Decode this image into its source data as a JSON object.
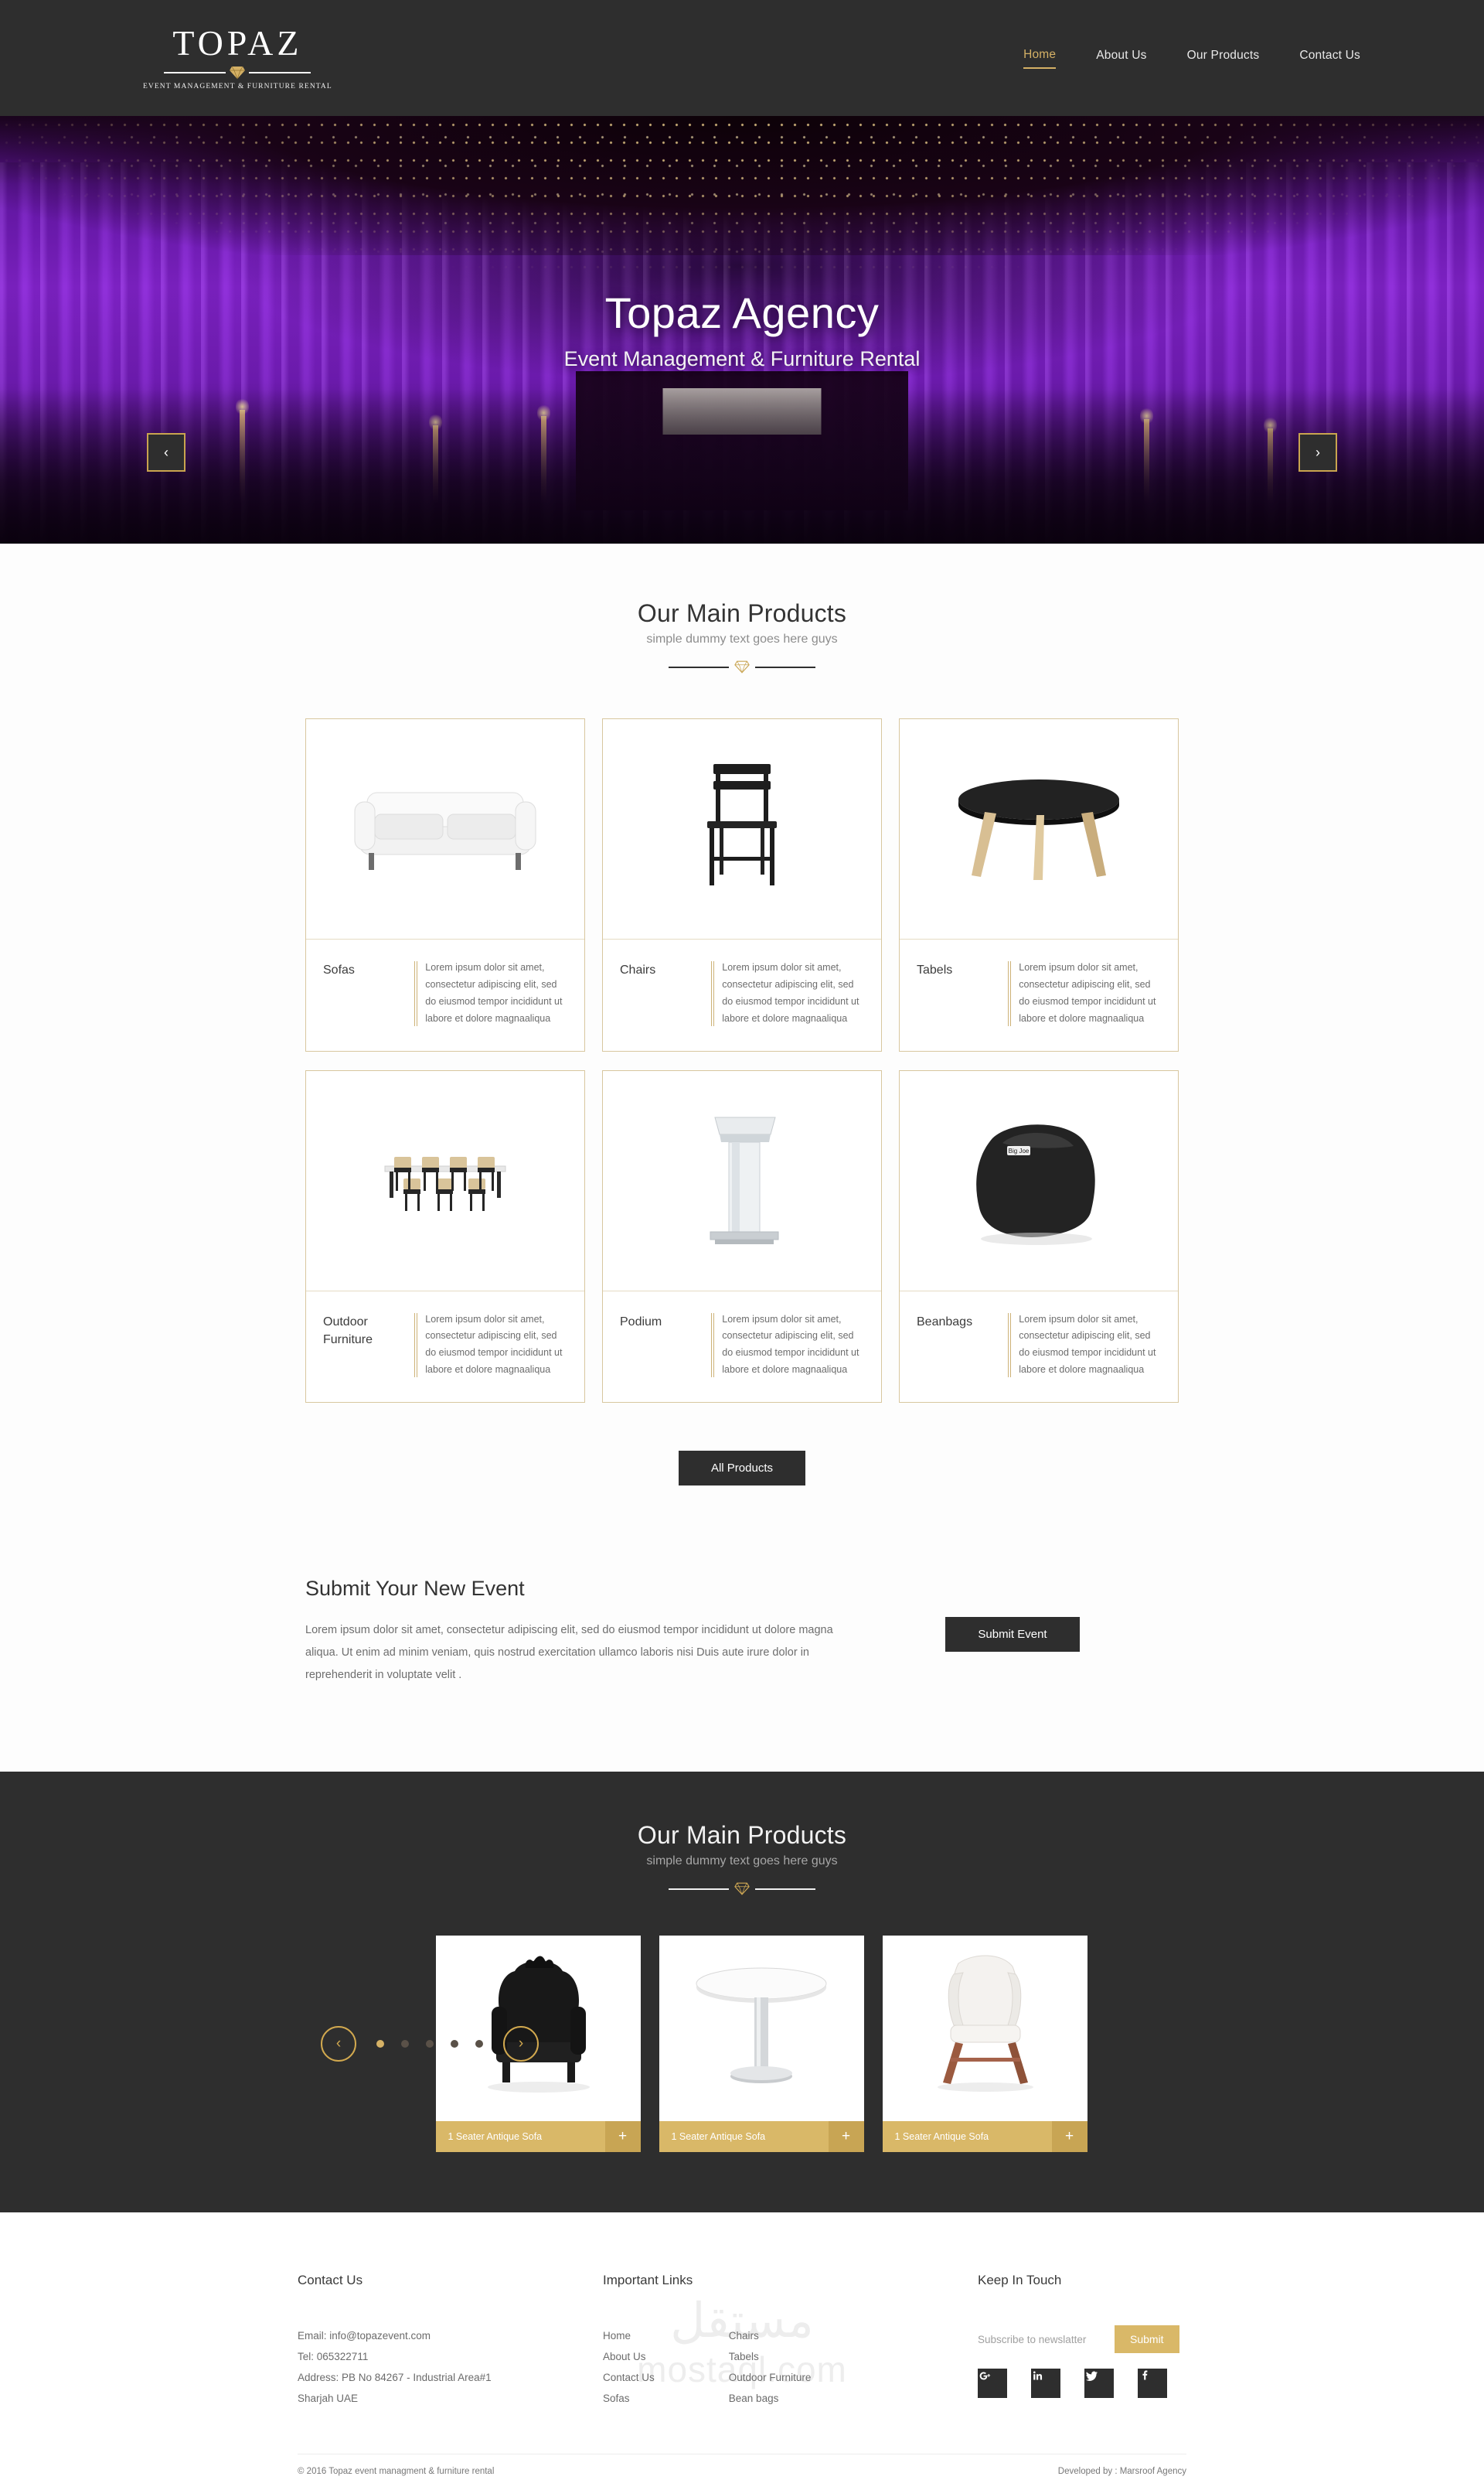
{
  "header": {
    "logo_word": "TOPAZ",
    "logo_tagline": "EVENT MANAGEMENT & FURNITURE RENTAL",
    "nav": [
      {
        "label": "Home",
        "active": true
      },
      {
        "label": "About Us",
        "active": false
      },
      {
        "label": "Our Products",
        "active": false
      },
      {
        "label": "Contact Us",
        "active": false
      }
    ]
  },
  "hero": {
    "title": "Topaz Agency",
    "subtitle": "Event Management & Furniture Rental",
    "prev_icon": "chevron-left-icon",
    "next_icon": "chevron-right-icon",
    "prev_glyph": "‹",
    "next_glyph": "›"
  },
  "products_section": {
    "title": "Our Main Products",
    "subtitle": "simple dummy text goes here guys",
    "all_products_label": "All Products",
    "desc_default": "Lorem ipsum dolor sit amet, consectetur adipiscing elit, sed do eiusmod tempor incididunt ut labore et dolore magnaaliqua",
    "cards": [
      {
        "name": "Sofas",
        "image": "white-two-seater-sofa",
        "desc": "Lorem ipsum dolor sit amet, consectetur adipiscing elit, sed do eiusmod tempor incididunt ut labore et dolore magnaaliqua"
      },
      {
        "name": "Chairs",
        "image": "black-wooden-chair",
        "desc": "Lorem ipsum dolor sit amet, consectetur adipiscing elit, sed do eiusmod tempor incididunt ut labore et dolore magnaaliqua"
      },
      {
        "name": "Tabels",
        "image": "round-black-top-table",
        "desc": "Lorem ipsum dolor sit amet, consectetur adipiscing elit, sed do eiusmod tempor incididunt ut labore et dolore magnaaliqua"
      },
      {
        "name": "Outdoor Furniture",
        "image": "outdoor-dining-set",
        "desc": "Lorem ipsum dolor sit amet, consectetur adipiscing elit, sed do eiusmod tempor incididunt ut labore et dolore magnaaliqua"
      },
      {
        "name": "Podium",
        "image": "glass-podium",
        "desc": "Lorem ipsum dolor sit amet, consectetur adipiscing elit, sed do eiusmod tempor incididunt ut labore et dolore magnaaliqua"
      },
      {
        "name": "Beanbags",
        "image": "black-beanbag",
        "desc": "Lorem ipsum dolor sit amet, consectetur adipiscing elit, sed do eiusmod tempor incididunt ut labore et dolore magnaaliqua"
      }
    ]
  },
  "submit_event": {
    "title": "Submit Your New Event",
    "text": "Lorem ipsum dolor sit amet, consectetur adipiscing elit, sed do eiusmod tempor incididunt ut dolore magna aliqua. Ut enim ad minim veniam, quis nostrud exercitation ullamco laboris nisi Duis aute irure dolor in reprehenderit in voluptate velit .",
    "button_label": "Submit Event"
  },
  "carousel_section": {
    "title": "Our Main Products",
    "subtitle": "simple dummy text goes here guys",
    "prev_glyph": "‹",
    "next_glyph": "›",
    "plus_glyph": "+",
    "dots": [
      true,
      false,
      false,
      false,
      false
    ],
    "items": [
      {
        "label": "1 Seater Antique Sofa",
        "image": "black-baroque-armchair"
      },
      {
        "label": "1 Seater Antique Sofa",
        "image": "round-white-pedestal-table"
      },
      {
        "label": "1 Seater Antique Sofa",
        "image": "white-wingback-lounge-chair"
      }
    ]
  },
  "footer": {
    "contact": {
      "title": "Contact Us",
      "email": "Email: info@topazevent.com",
      "tel": "Tel: 065322711",
      "address_line1": "Address: PB No 84267 - Industrial Area#1",
      "address_line2": "Sharjah UAE"
    },
    "links": {
      "title": "Important Links",
      "col1": [
        "Home",
        "About Us",
        "Contact Us",
        "Sofas"
      ],
      "col2": [
        "Chairs",
        "Tabels",
        "Outdoor Furniture",
        "Bean bags"
      ]
    },
    "keep_in_touch": {
      "title": "Keep In Touch",
      "placeholder": "Subscribe to newslatter",
      "value": "",
      "submit_label": "Submit",
      "socials": [
        {
          "name": "google-plus-icon",
          "glyph": "G+"
        },
        {
          "name": "linkedin-icon",
          "glyph": "in"
        },
        {
          "name": "twitter-icon",
          "glyph": "🐦"
        },
        {
          "name": "facebook-icon",
          "glyph": "f"
        }
      ]
    },
    "watermark_ar": "مستقل",
    "watermark_en": "mostaql.com",
    "copyright": "© 2016 Topaz event managment & furniture rental",
    "developed_by": "Developed by : Marsroof Agency"
  },
  "colors": {
    "gold": "#d4b065",
    "dark": "#2e2e2e",
    "gold_button": "#d9b868",
    "card_border": "#d8c79f"
  }
}
